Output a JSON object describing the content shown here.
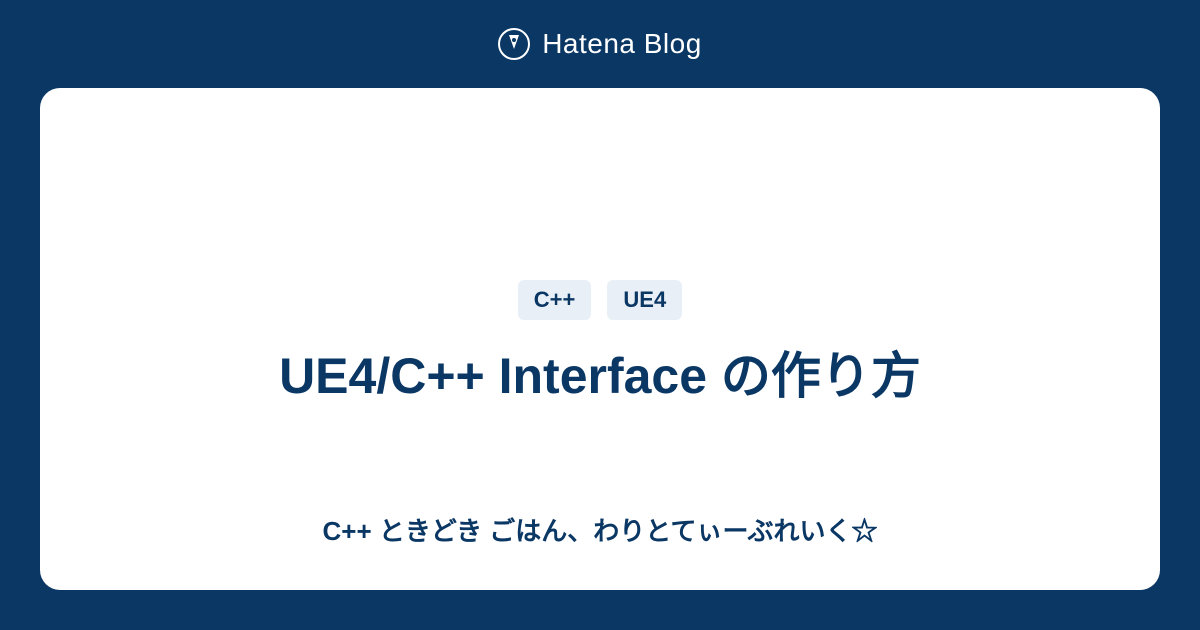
{
  "header": {
    "brand": "Hatena Blog"
  },
  "card": {
    "tags": [
      "C++",
      "UE4"
    ],
    "title": "UE4/C++ Interface の作り方",
    "subtitle": "C++ ときどき ごはん、わりとてぃーぶれいく☆"
  },
  "colors": {
    "background": "#0a3764",
    "card_bg": "#ffffff",
    "tag_bg": "#e8eff6",
    "text_primary": "#0a3764"
  }
}
